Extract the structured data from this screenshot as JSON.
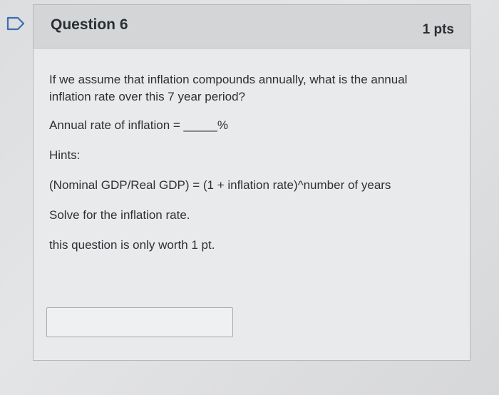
{
  "question": {
    "title": "Question 6",
    "points": "1 pts",
    "prompt": "If we assume that inflation compounds annually, what is the annual inflation rate over this 7 year period?",
    "answer_line": "Annual rate of inflation = _____%",
    "hints_label": "Hints:",
    "hint_formula": "(Nominal GDP/Real GDP) = (1 + inflation rate)^number of years",
    "hint_solve": "Solve for the inflation rate.",
    "worth_note": "this question is only worth 1 pt."
  },
  "answer_input": {
    "value": "",
    "placeholder": ""
  },
  "icons": {
    "flag": "flag-outline-icon"
  },
  "colors": {
    "header_bg": "#d3d5d7",
    "flag_border": "#3a6fb0"
  }
}
